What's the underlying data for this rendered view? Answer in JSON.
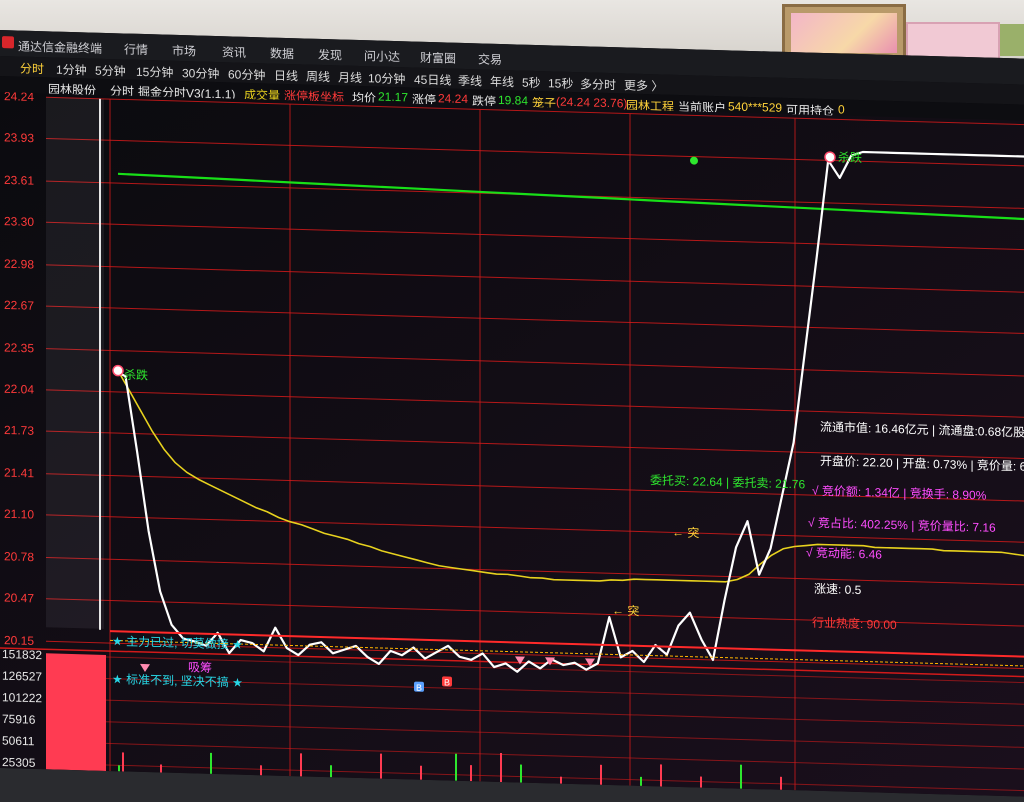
{
  "app": {
    "title": "通达信金融终端"
  },
  "menu": [
    "行情",
    "市场",
    "资讯",
    "数据",
    "发现",
    "问小达",
    "财富圈",
    "交易"
  ],
  "periods": [
    "分时",
    "1分钟",
    "5分钟",
    "15分钟",
    "30分钟",
    "60分钟",
    "日线",
    "周线",
    "月线",
    "10分钟",
    "45日线",
    "季线",
    "年线",
    "5秒",
    "15秒",
    "多分时",
    "更多 〉"
  ],
  "active_period": "分时",
  "ticker": {
    "stock": "园林股份",
    "mode": "分时",
    "indicator": "掘金分时V3(1,1,1)",
    "volume_label": "成交量",
    "limit_label": "涨停板坐标",
    "avg_label": "均价",
    "avg_value": "21.17",
    "up_limit_label": "涨停",
    "up_limit_value": "24.24",
    "down_limit_label": "跌停",
    "down_limit_value": "19.84",
    "cage_label": "笼子",
    "cage_value": "(24.24 23.76)",
    "board": "园林工程",
    "account_label": "当前账户",
    "account_value": "540***529",
    "hold_label": "可用持仓",
    "hold_value": "0"
  },
  "info_panel": {
    "line1": "流通市值: 16.46亿元 | 流通盘:0.68亿股",
    "line2": "开盘价: 22.20 | 开盘: 0.73% | 竞价量: 6",
    "line3_green": "委托买: 22.64 | 委托卖: 21.76",
    "line3_pink": "√ 竞价额: 1.34亿 | 竞换手: 8.90%",
    "line4": "√ 竞占比: 402.25% | 竞价量比: 7.16",
    "line5": "√ 竞动能: 6.46",
    "line6": "涨速: 0.5",
    "line7": "行业热度: 90.00"
  },
  "annotations": {
    "top_left_marker": "24.24",
    "label_cross_1": "杀跌",
    "label_cross_2": "杀跌",
    "label_buy_1": "突",
    "label_buy_2": "突",
    "star_line_1": "★ 主力已过, 切莫做接 ★",
    "star_line_2": "★ 标准不到, 坚决不搞 ★",
    "absorb": "吸筹",
    "b_mark": "B",
    "s_mark": "B"
  },
  "colors": {
    "price_line": "#ffffff",
    "avg_line": "#e8d21e",
    "ma_line": "#18e018",
    "grid_red": "#d21a1a",
    "up_text": "#ff3a3a",
    "down_text": "#2ee62e"
  },
  "chart_data": {
    "type": "line",
    "title": "",
    "ylabel": "",
    "xlabel": "",
    "price_ticks": [
      "24.24",
      "23.93",
      "23.61",
      "23.30",
      "22.98",
      "22.67",
      "22.35",
      "22.04",
      "21.73",
      "21.41",
      "21.10",
      "20.78",
      "20.47",
      "20.15"
    ],
    "volume_ticks": [
      "151832",
      "126527",
      "101222",
      "75916",
      "50611",
      "25305"
    ],
    "ylim": [
      20.15,
      24.24
    ],
    "series": [
      {
        "role": "price",
        "values": [
          22.2,
          22.16,
          21.6,
          21.0,
          20.55,
          20.3,
          20.2,
          20.18,
          20.15,
          20.25,
          20.1,
          20.2,
          20.18,
          20.12,
          20.3,
          20.15,
          20.1,
          20.18,
          20.2,
          20.12,
          20.15,
          20.18,
          20.1,
          20.05,
          20.15,
          20.12,
          20.18,
          20.1,
          20.15,
          20.2,
          20.12,
          20.1,
          20.15,
          20.05,
          20.08,
          20.02,
          20.1,
          20.05,
          20.12,
          20.08,
          20.1,
          20.05,
          20.1,
          20.45,
          20.15,
          20.2,
          20.12,
          20.25,
          20.18,
          20.4,
          20.5,
          20.3,
          20.15,
          20.6,
          21.0,
          21.2,
          20.8,
          21.0,
          21.4,
          21.8,
          22.5,
          23.2,
          23.93,
          23.8,
          23.97,
          24.0,
          24.0,
          24.0,
          24.0,
          24.0,
          24.0,
          24.0,
          24.0,
          24.0,
          24.0,
          24.0,
          24.0,
          24.0,
          24.0,
          24.0
        ]
      },
      {
        "role": "average",
        "values": [
          22.2,
          22.05,
          21.9,
          21.75,
          21.62,
          21.52,
          21.45,
          21.4,
          21.36,
          21.32,
          21.28,
          21.24,
          21.2,
          21.17,
          21.13,
          21.1,
          21.08,
          21.05,
          21.02,
          21.0,
          20.98,
          20.95,
          20.93,
          20.9,
          20.88,
          20.86,
          20.84,
          20.82,
          20.8,
          20.79,
          20.78,
          20.77,
          20.76,
          20.75,
          20.75,
          20.74,
          20.73,
          20.73,
          20.72,
          20.72,
          20.72,
          20.72,
          20.72,
          20.73,
          20.73,
          20.74,
          20.74,
          20.74,
          20.74,
          20.74,
          20.74,
          20.74,
          20.74,
          20.74,
          20.76,
          20.8,
          20.88,
          20.95,
          21.0,
          21.02,
          21.03,
          21.04,
          21.04,
          21.04,
          21.04,
          21.04,
          21.03,
          21.03,
          21.03,
          21.03,
          21.03,
          21.03,
          21.02,
          21.02,
          21.02,
          21.02,
          21.02,
          21.02,
          21.01,
          21.0
        ]
      },
      {
        "role": "ma",
        "values": [
          23.68,
          23.67,
          23.66,
          23.65,
          23.64,
          23.63,
          23.62,
          23.61,
          23.6,
          23.59,
          23.58,
          23.57,
          23.56,
          23.55,
          23.54,
          23.53
        ]
      }
    ]
  }
}
